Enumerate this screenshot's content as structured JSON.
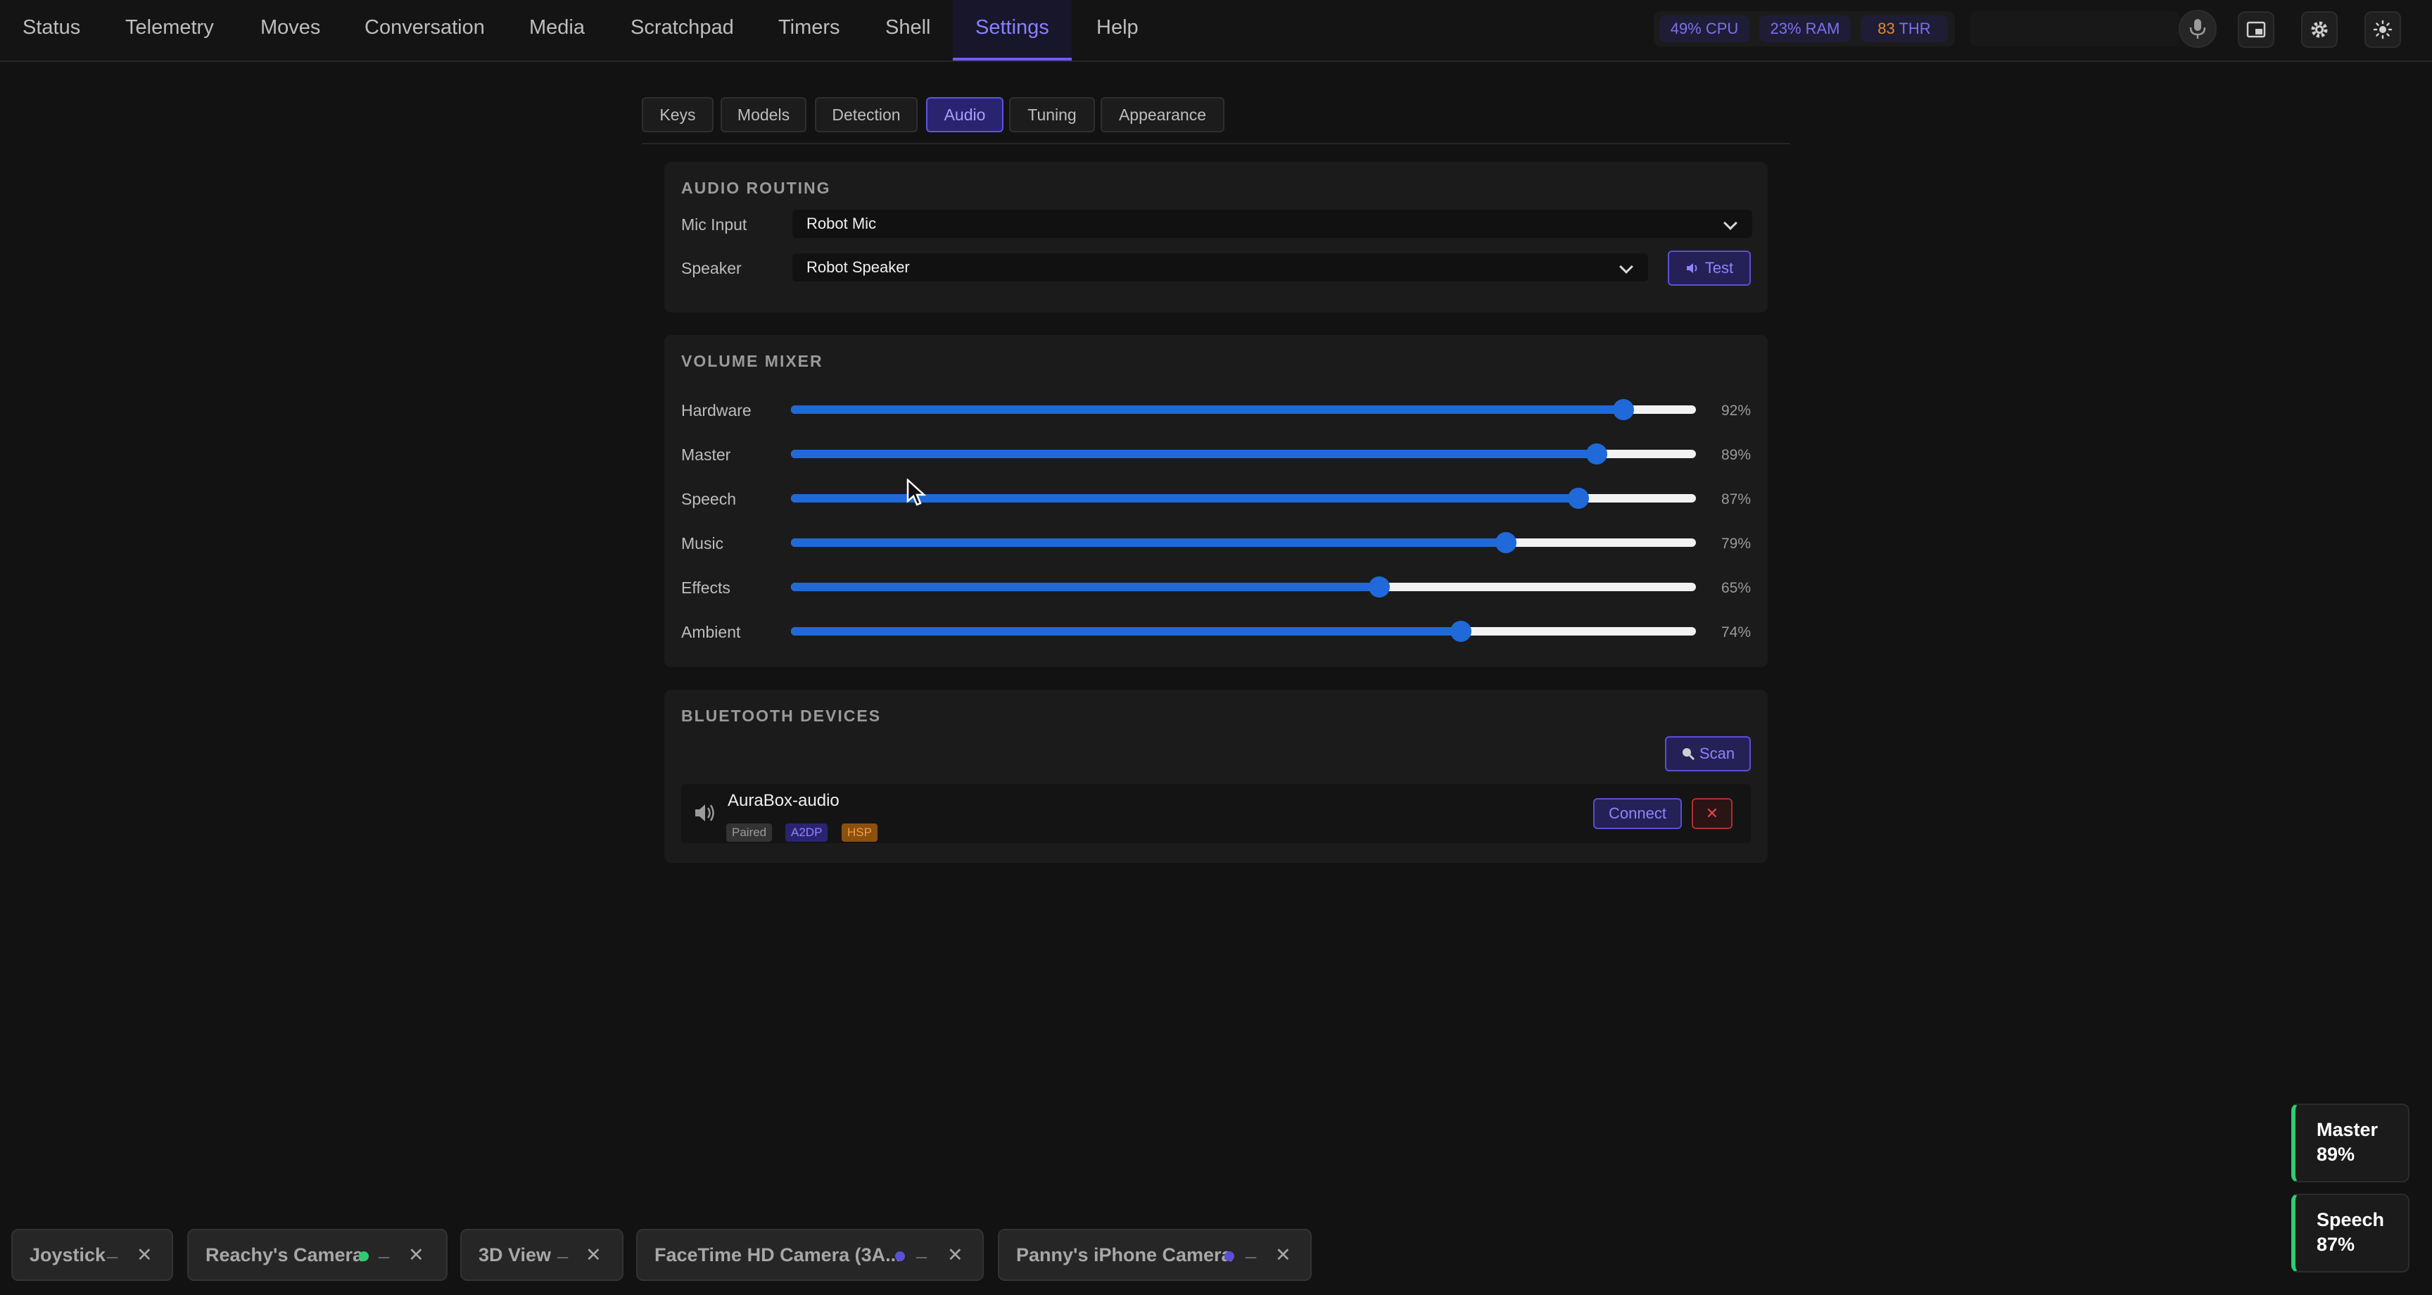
{
  "nav": {
    "tabs": [
      "Status",
      "Telemetry",
      "Moves",
      "Conversation",
      "Media",
      "Scratchpad",
      "Timers",
      "Shell",
      "Settings",
      "Help"
    ],
    "active_tab": "Settings",
    "stats": {
      "cpu": "49% CPU",
      "ram": "23% RAM",
      "thr_value": "83",
      "thr_label": "THR"
    },
    "icons": [
      "microphone-icon",
      "picture-in-picture-icon",
      "gear-icon",
      "sun-icon"
    ]
  },
  "settings_tabs": {
    "items": [
      "Keys",
      "Models",
      "Detection",
      "Audio",
      "Tuning",
      "Appearance"
    ],
    "active": "Audio"
  },
  "audio_routing": {
    "title": "AUDIO ROUTING",
    "mic_label": "Mic Input",
    "mic_value": "Robot Mic",
    "speaker_label": "Speaker",
    "speaker_value": "Robot Speaker",
    "test_label": "Test"
  },
  "volume_mixer": {
    "title": "VOLUME MIXER",
    "channels": [
      {
        "label": "Hardware",
        "value": 92,
        "display": "92%"
      },
      {
        "label": "Master",
        "value": 89,
        "display": "89%"
      },
      {
        "label": "Speech",
        "value": 87,
        "display": "87%"
      },
      {
        "label": "Music",
        "value": 79,
        "display": "79%"
      },
      {
        "label": "Effects",
        "value": 65,
        "display": "65%"
      },
      {
        "label": "Ambient",
        "value": 74,
        "display": "74%"
      }
    ]
  },
  "bluetooth": {
    "title": "BLUETOOTH DEVICES",
    "scan_label": "Scan",
    "device": {
      "name": "AuraBox-audio",
      "tags": [
        "Paired",
        "A2DP",
        "HSP"
      ],
      "connect_label": "Connect",
      "remove_label": "✕"
    }
  },
  "dock": {
    "windows": [
      {
        "label": "Joystick",
        "min": "_",
        "close": "✕"
      },
      {
        "label": "Reachy's Camera",
        "min": "_",
        "close": "✕",
        "dot": "#2ecc71"
      },
      {
        "label": "3D View",
        "min": "_",
        "close": "✕"
      },
      {
        "label": "FaceTime HD Camera (3A...",
        "min": "_",
        "close": "✕",
        "dot": "#5b4fd6"
      },
      {
        "label": "Panny's iPhone Camera",
        "min": "_",
        "close": "✕",
        "dot": "#5b4fd6"
      }
    ]
  },
  "hud": [
    {
      "name": "Master",
      "value": "89%"
    },
    {
      "name": "Speech",
      "value": "87%"
    }
  ],
  "colors": {
    "accent": "#6d5cf0",
    "slider": "#1f6ad8",
    "ok": "#2ecc71",
    "danger": "#d33a3a",
    "warn": "#e08a2e"
  }
}
